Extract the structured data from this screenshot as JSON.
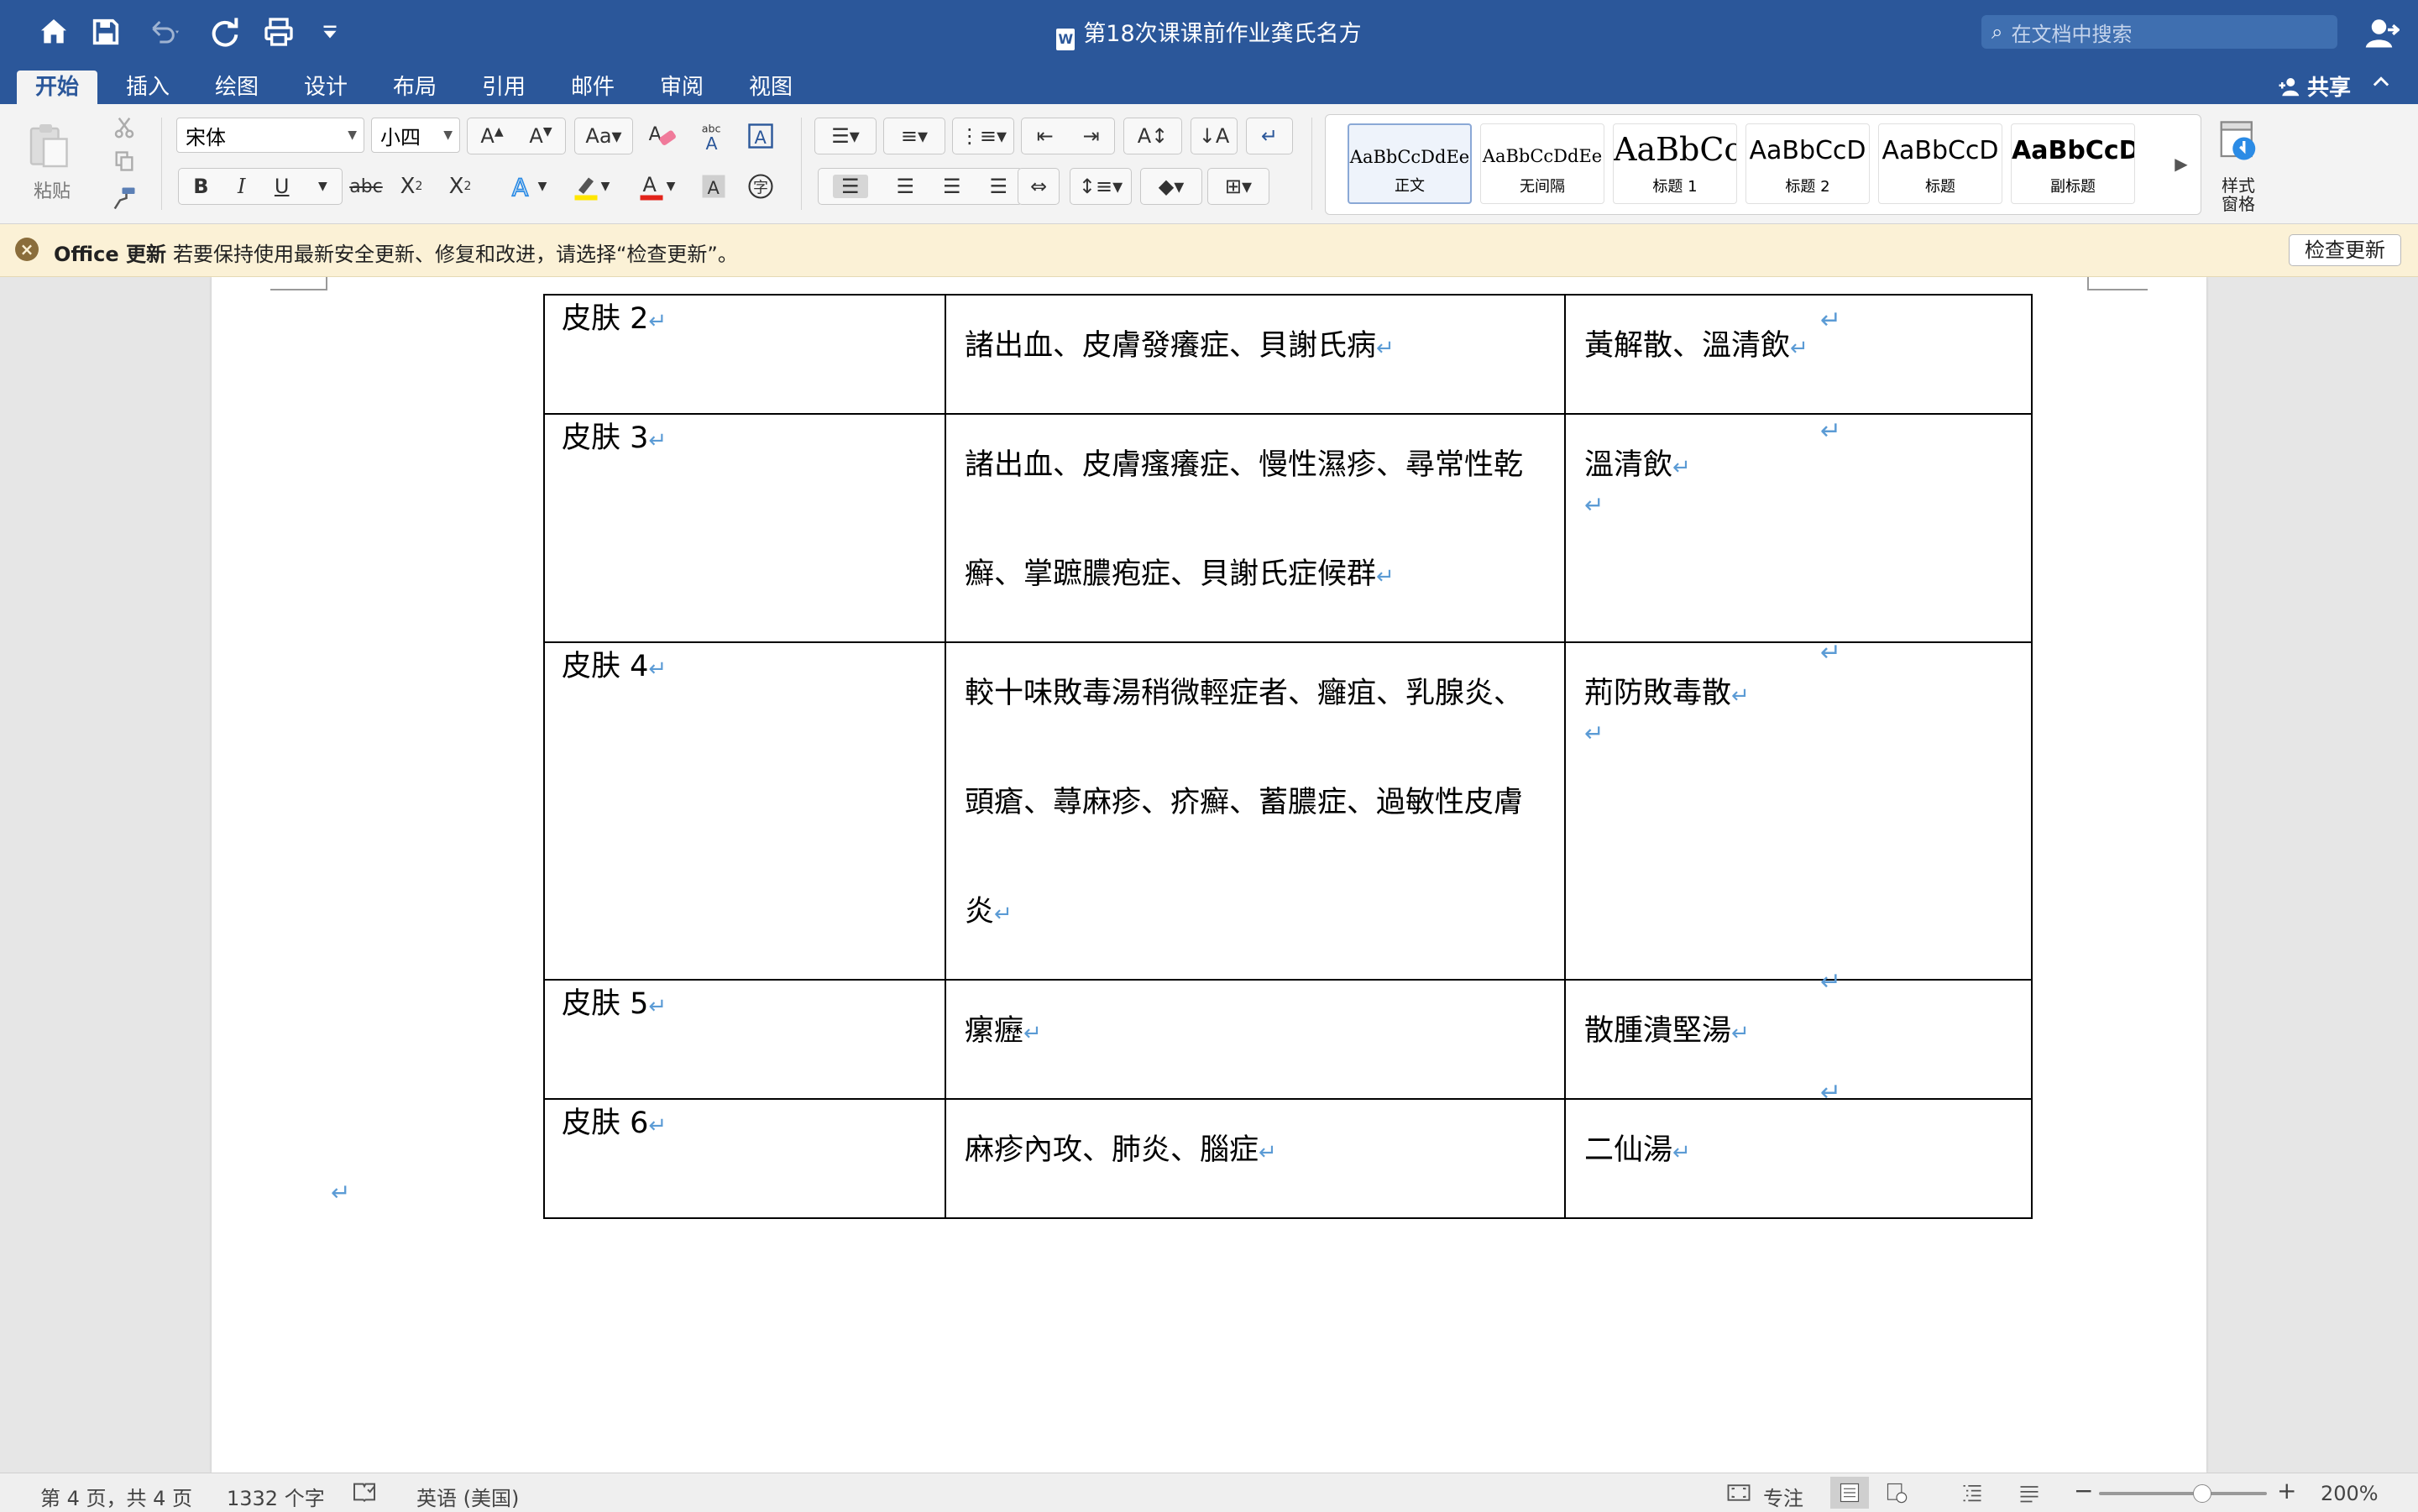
{
  "window": {
    "doc_title": "第18次课课前作业龚氏名方",
    "search_placeholder": "在文档中搜索"
  },
  "tabs": [
    "开始",
    "插入",
    "绘图",
    "设计",
    "布局",
    "引用",
    "邮件",
    "审阅",
    "视图"
  ],
  "share_label": "共享",
  "ribbon": {
    "paste_label": "粘贴",
    "font_name": "宋体",
    "font_size": "小四",
    "styles": [
      {
        "preview": "AaBbCcDdEe",
        "label": "正文"
      },
      {
        "preview": "AaBbCcDdEe",
        "label": "无间隔"
      },
      {
        "preview": "AaBbCc",
        "label": "标题 1"
      },
      {
        "preview": "AaBbCcD",
        "label": "标题 2"
      },
      {
        "preview": "AaBbCcD",
        "label": "标题"
      },
      {
        "preview": "AaBbCcD",
        "label": "副标题"
      }
    ],
    "styles_pane_label_1": "样式",
    "styles_pane_label_2": "窗格"
  },
  "update_bar": {
    "title": "Office 更新",
    "message": "若要保持使用最新安全更新、修复和改进，请选择“检查更新”。",
    "button": "检查更新"
  },
  "table": {
    "rows": [
      {
        "c1": "皮肤 2",
        "c2": "諸出血、皮膚發癢症、貝謝氏病",
        "c3": "黃解散、溫清飲"
      },
      {
        "c1": "皮肤 3",
        "c2": "諸出血、皮膚瘙癢症、慢性濕疹、尋常性乾癬、掌蹠膿疱症、貝謝氏症候群",
        "c3": "溫清飲"
      },
      {
        "c1": "皮肤 4",
        "c2": "較十味敗毒湯稍微輕症者、癰疽、乳腺炎、頭瘡、蕁麻疹、疥癬、蓄膿症、過敏性皮膚炎",
        "c3": "荊防敗毒散"
      },
      {
        "c1": "皮肤 5",
        "c2": "瘰癧",
        "c3": "散腫潰堅湯"
      },
      {
        "c1": "皮肤 6",
        "c2": "麻疹內攻、肺炎、腦症",
        "c3": "二仙湯"
      }
    ]
  },
  "paragraph_mark": "↵",
  "status": {
    "page_info": "第 4 页，共 4 页",
    "word_count": "1332 个字",
    "language": "英语 (美国)",
    "focus_label": "专注",
    "zoom": "200%"
  }
}
